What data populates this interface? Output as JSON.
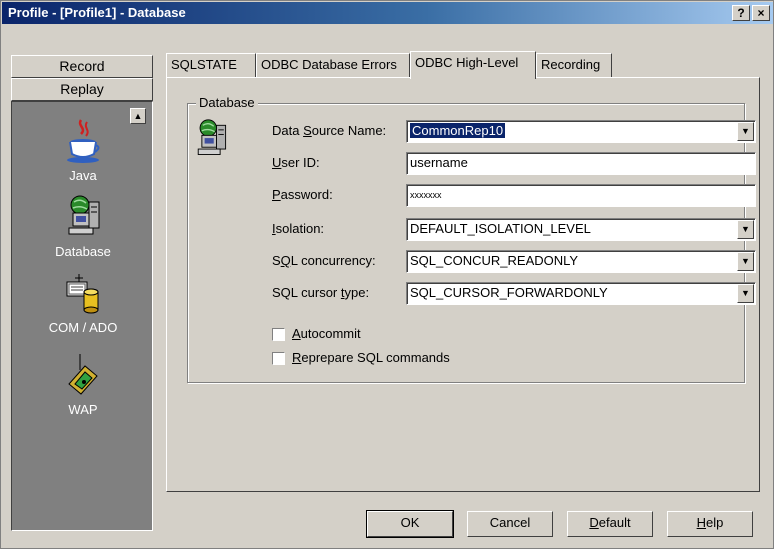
{
  "window": {
    "title": "Profile - [Profile1] - Database",
    "help_glyph": "?",
    "close_glyph": "×"
  },
  "left_panel": {
    "buttons": [
      "Record",
      "Replay"
    ],
    "scroll_up_glyph": "▲",
    "items": [
      {
        "label": "Java",
        "icon": "java-icon"
      },
      {
        "label": "Database",
        "icon": "database-icon"
      },
      {
        "label": "COM / ADO",
        "icon": "com-ado-icon"
      },
      {
        "label": "WAP",
        "icon": "wap-icon"
      }
    ]
  },
  "tabs": [
    {
      "label": "SQLSTATE",
      "active": false
    },
    {
      "label": "ODBC Database Errors",
      "active": false
    },
    {
      "label": "ODBC High-Level",
      "active": true
    },
    {
      "label": "Recording",
      "active": false
    }
  ],
  "database_group": {
    "title": "Database",
    "fields": {
      "dsn": {
        "label_pre": "Data ",
        "label_u": "S",
        "label_post": "ource Name:",
        "value": "CommonRep10"
      },
      "user": {
        "label_pre": "",
        "label_u": "U",
        "label_post": "ser ID:",
        "value": "username"
      },
      "password": {
        "label_pre": "",
        "label_u": "P",
        "label_post": "assword:",
        "value": "xxxxxxx"
      },
      "isolation": {
        "label_pre": "",
        "label_u": "I",
        "label_post": "solation:",
        "value": "DEFAULT_ISOLATION_LEVEL"
      },
      "concurrency": {
        "label_pre": "S",
        "label_u": "Q",
        "label_post": "L concurrency:",
        "value": "SQL_CONCUR_READONLY"
      },
      "cursor": {
        "label_pre": "SQL cursor ",
        "label_u": "t",
        "label_post": "ype:",
        "value": "SQL_CURSOR_FORWARDONLY"
      }
    },
    "dropdown_glyph": "▼",
    "checkboxes": {
      "autocommit": {
        "label_pre": "",
        "label_u": "A",
        "label_post": "utocommit",
        "checked": false
      },
      "reprepare": {
        "label_pre": "",
        "label_u": "R",
        "label_post": "eprepare SQL commands",
        "checked": false
      }
    }
  },
  "buttons": {
    "ok": "OK",
    "cancel": "Cancel",
    "default": {
      "label_u": "D",
      "label_post": "efault"
    },
    "help": {
      "label_u": "H",
      "label_post": "elp"
    }
  }
}
